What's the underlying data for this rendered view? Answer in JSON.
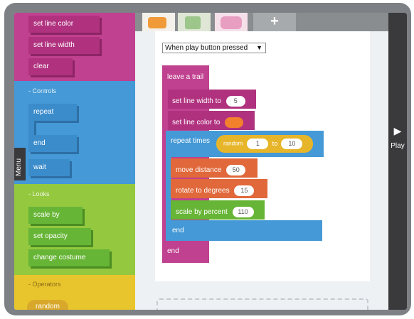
{
  "palette": {
    "pen_blocks": [
      "set line color",
      "set line width",
      "clear"
    ],
    "controls": {
      "title": "- Controls",
      "blocks": [
        "repeat",
        "end",
        "wait"
      ]
    },
    "looks": {
      "title": "- Looks",
      "blocks": [
        "scale by",
        "set opacity",
        "change costume"
      ]
    },
    "operators": {
      "title": "- Operators",
      "blocks": [
        "random"
      ]
    }
  },
  "menu_tab": {
    "label": "Menu"
  },
  "tabs": {
    "add_label": "+"
  },
  "event_select": {
    "value": "When play button pressed"
  },
  "script": {
    "leave_trail": "leave a trail",
    "set_line_width": {
      "label": "set line width to",
      "value": "5"
    },
    "set_line_color": {
      "label": "set line color to",
      "color": "#f2802d"
    },
    "repeat": {
      "label": "repeat times",
      "random_label": "random",
      "from": "1",
      "to_label": "to",
      "to": "10"
    },
    "move": {
      "label": "move distance",
      "value": "50"
    },
    "rotate": {
      "label": "rotate to degrees",
      "value": "15"
    },
    "scale": {
      "label": "scale by percent",
      "value": "110"
    },
    "inner_end": "end",
    "outer_end": "end"
  },
  "play": {
    "label": "Play",
    "icon": "play-triangle-icon"
  },
  "colors": {
    "pen": "#c0418f",
    "controls": "#4499d6",
    "looks": "#94c83f",
    "operators": "#e9c52d",
    "motion": "#e0683a",
    "random": "#e7b52a",
    "frame": "#7d8185"
  }
}
